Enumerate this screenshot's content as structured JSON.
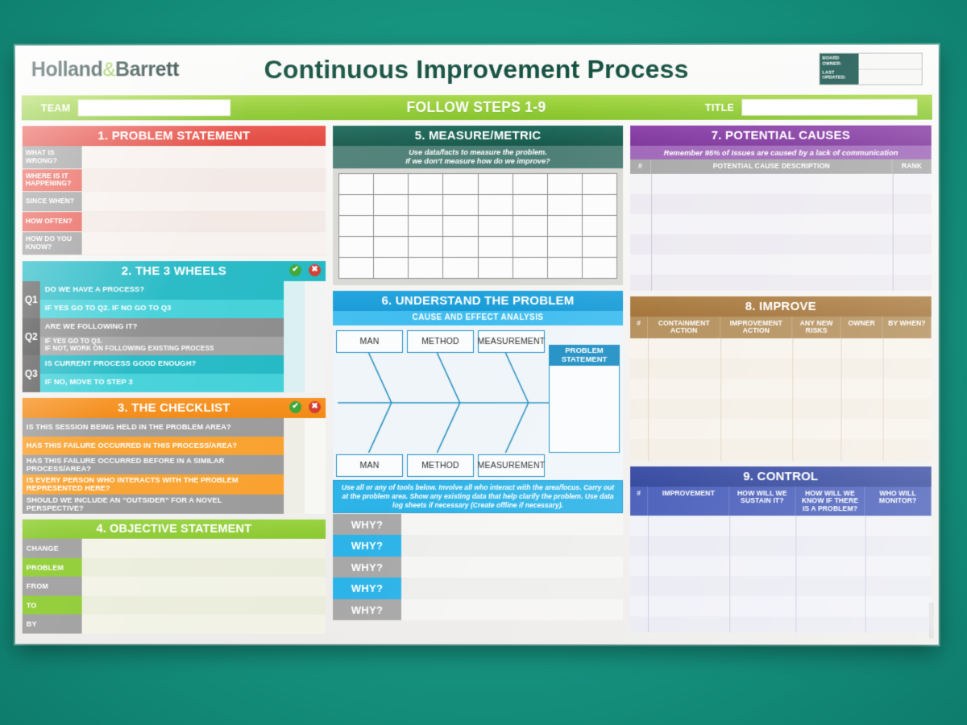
{
  "header": {
    "logo_text": "Holland",
    "logo_amp": "&",
    "logo_text2": "Barrett",
    "title": "Continuous Improvement Process",
    "owner_label": "BOARD OWNER:",
    "last_updated_label": "LAST UPDATED:"
  },
  "banner": {
    "team_label": "TEAM",
    "team_value": "",
    "center_text": "FOLLOW STEPS 1-9",
    "title_label": "TITLE",
    "title_value": ""
  },
  "section1": {
    "title": "1.  PROBLEM STATEMENT",
    "rows": [
      {
        "label": "WHAT IS WRONG?",
        "style": "gray",
        "value": ""
      },
      {
        "label": "WHERE IS IT HAPPENING?",
        "style": "red",
        "value": ""
      },
      {
        "label": "SINCE WHEN?",
        "style": "gray",
        "value": ""
      },
      {
        "label": "HOW OFTEN?",
        "style": "red",
        "value": ""
      },
      {
        "label": "HOW DO YOU KNOW?",
        "style": "gray",
        "value": ""
      }
    ]
  },
  "section2": {
    "title": "2. THE 3 WHEELS",
    "tick_icon": "check-icon",
    "cross_icon": "cross-icon",
    "questions": [
      {
        "q": "Q1",
        "prompt": "DO WE HAVE A PROCESS?",
        "note": "IF YES GO TO Q2. IF NO GO TO Q3"
      },
      {
        "q": "Q2",
        "prompt": "ARE WE FOLLOWING IT?",
        "note": "IF YES GO TO Q3.\nIF NOT, WORK ON FOLLOWING EXISTING PROCESS"
      },
      {
        "q": "Q3",
        "prompt": "IS CURRENT PROCESS GOOD ENOUGH?",
        "note": "IF NO, MOVE TO STEP 3"
      }
    ]
  },
  "section3": {
    "title": "3. THE CHECKLIST",
    "tick_icon": "check-icon",
    "cross_icon": "cross-icon",
    "items": [
      "IS THIS SESSION BEING HELD IN THE PROBLEM AREA?",
      "HAS THIS FAILURE OCCURRED IN THIS PROCESS/AREA?",
      "HAS THIS FAILURE OCCURRED BEFORE IN A SIMILAR PROCESS/AREA?",
      "IS EVERY PERSON WHO INTERACTS WITH THE PROBLEM REPRESENTED HERE?",
      "SHOULD WE INCLUDE AN “OUTSIDER” FOR A NOVEL PERSPECTIVE?"
    ]
  },
  "section4": {
    "title": "4. OBJECTIVE STATEMENT",
    "rows": [
      {
        "label": "CHANGE",
        "style": "gray",
        "value": ""
      },
      {
        "label": "PROBLEM",
        "style": "lime",
        "value": ""
      },
      {
        "label": "FROM",
        "style": "gray",
        "value": ""
      },
      {
        "label": "TO",
        "style": "lime",
        "value": ""
      },
      {
        "label": "BY",
        "style": "gray",
        "value": ""
      }
    ]
  },
  "section5": {
    "title": "5. MEASURE/METRIC",
    "subtitle": "Use data/facts to measure the problem.\nIf we don’t measure how do we improve?",
    "grid_cols": 8,
    "grid_rows": 5
  },
  "section6": {
    "title": "6. UNDERSTAND THE PROBLEM",
    "subtitle": "CAUSE AND EFFECT ANALYSIS",
    "bones_top": [
      "MAN",
      "METHOD",
      "MEASUREMENT"
    ],
    "bones_bottom": [
      "MAN",
      "METHOD",
      "MEASUREMENT"
    ],
    "effect_label": "PROBLEM\nSTATEMENT",
    "note": "Use all or any of tools below. Involve all who interact with the area/focus. Carry out at the problem area. Show any existing data that help clarify the problem. Use data log sheets if necessary (Create offline if necessary).",
    "whys": [
      "WHY?",
      "WHY?",
      "WHY?",
      "WHY?",
      "WHY?"
    ]
  },
  "section7": {
    "title": "7. POTENTIAL CAUSES",
    "subtitle": "Remember 95% of Issues are caused by a lack of communication",
    "columns": [
      "#",
      "POTENTIAL CAUSE DESCRIPTION",
      "RANK"
    ],
    "rows": 6
  },
  "section8": {
    "title": "8. IMPROVE",
    "columns": [
      "#",
      "CONTAINMENT ACTION",
      "IMPROVEMENT ACTION",
      "ANY NEW RISKS",
      "OWNER",
      "BY WHEN?"
    ],
    "rows": 6
  },
  "section9": {
    "title": "9. CONTROL",
    "columns": [
      "#",
      "IMPROVEMENT",
      "HOW WILL WE SUSTAIN IT?",
      "HOW WILL WE KNOW IF THERE IS A PROBLEM?",
      "WHO WILL MONITOR?"
    ],
    "rows": 6
  },
  "colors": {
    "background": "#16967f",
    "title": "#14503f",
    "banner_green": "#93cc35",
    "s1_red": "#e04238",
    "s2_teal": "#1fb8c4",
    "s3_orange": "#f2860f",
    "s4_lime": "#8ac82f",
    "s5_dark_green": "#1f6b5c",
    "s6_blue": "#179ad6",
    "s7_purple": "#7b3199",
    "s8_brown": "#9d6b2e",
    "s9_navy": "#223792",
    "check_green": "#3aa534",
    "cross_red": "#d23a2e"
  }
}
